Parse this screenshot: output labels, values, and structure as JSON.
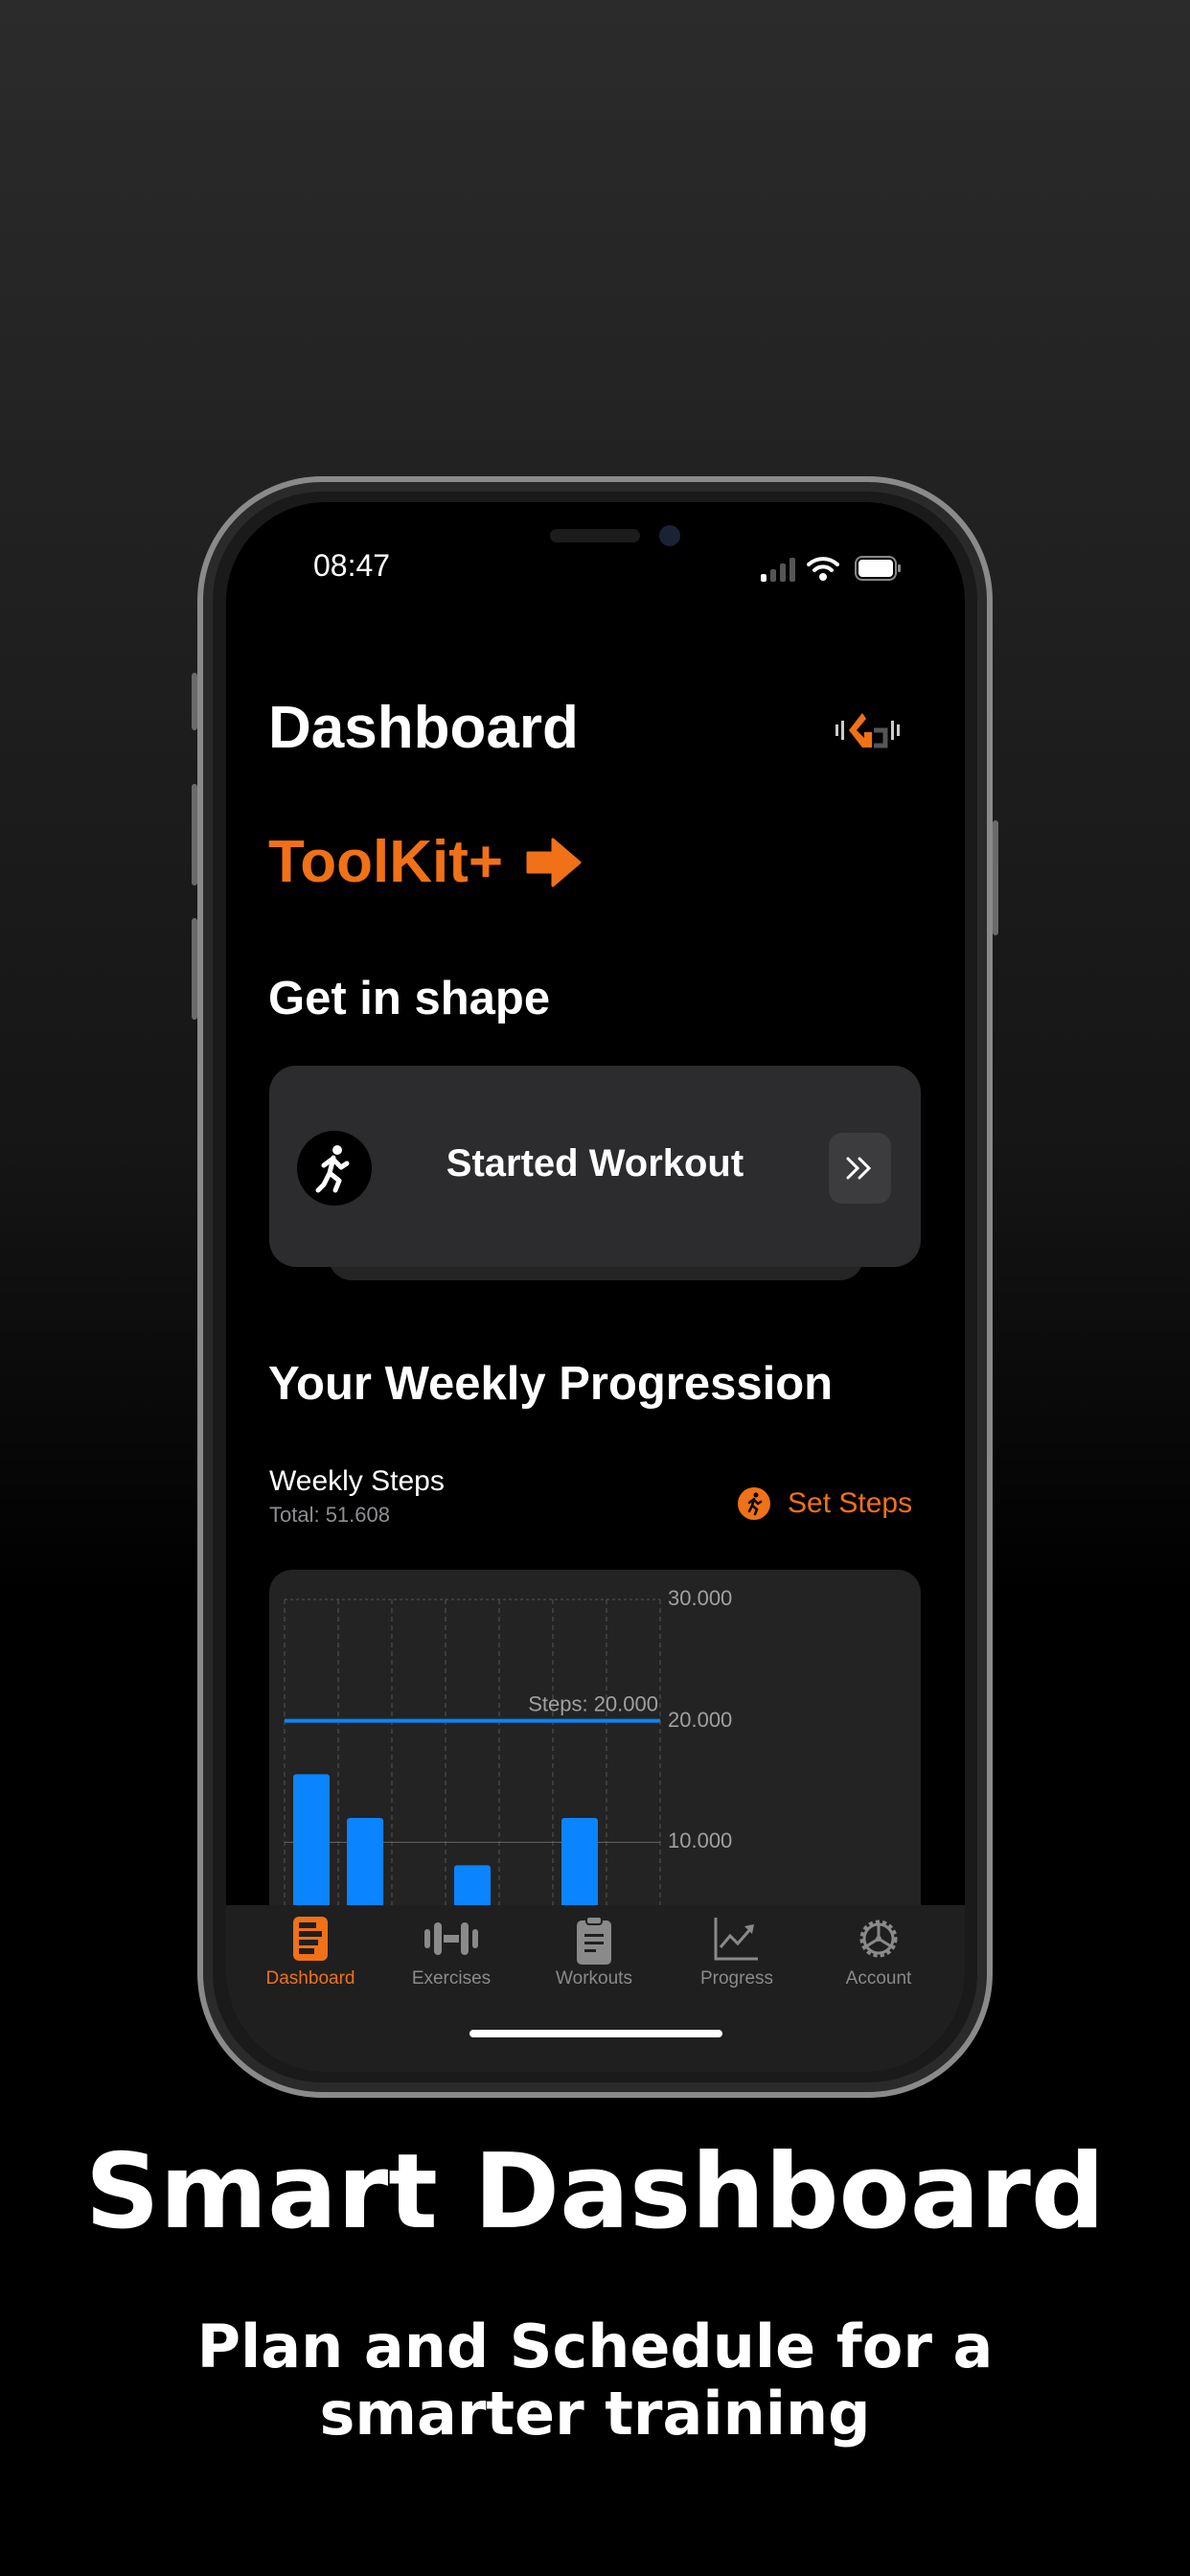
{
  "status_bar": {
    "time": "08:47"
  },
  "header": {
    "title": "Dashboard",
    "logo": "gym-logo-icon"
  },
  "promo": {
    "label": "ToolKit+"
  },
  "section_shape": {
    "title": "Get in shape",
    "card_label": "Started Workout"
  },
  "section_progress": {
    "title": "Your Weekly Progression",
    "chart_title": "Weekly Steps",
    "total": "Total: 51.608",
    "set_steps_label": "Set Steps"
  },
  "colors": {
    "accent": "#F07117",
    "bar": "#0A84FF",
    "card": "#2C2C2E"
  },
  "chart_data": {
    "type": "bar",
    "title": "Weekly Steps",
    "values": [
      15600,
      12000,
      0,
      8100,
      0,
      12000,
      0
    ],
    "ylim": [
      0,
      30000
    ],
    "y_ticks": [
      "30.000",
      "20.000",
      "10.000"
    ],
    "y_tick_values": [
      30000,
      20000,
      10000
    ],
    "goal_line": {
      "value": 20000,
      "label": "Steps: 20.000"
    },
    "grid": true,
    "y_axis": "right"
  },
  "tab_bar": {
    "items": [
      {
        "label": "Dashboard",
        "icon": "dashboard-icon",
        "active": true
      },
      {
        "label": "Exercises",
        "icon": "dumbbell-icon",
        "active": false
      },
      {
        "label": "Workouts",
        "icon": "clipboard-icon",
        "active": false
      },
      {
        "label": "Progress",
        "icon": "chart-icon",
        "active": false
      },
      {
        "label": "Account",
        "icon": "gear-icon",
        "active": false
      }
    ]
  },
  "marketing": {
    "headline": "Smart Dashboard",
    "subline1": "Plan and Schedule for a",
    "subline2": "smarter training"
  }
}
